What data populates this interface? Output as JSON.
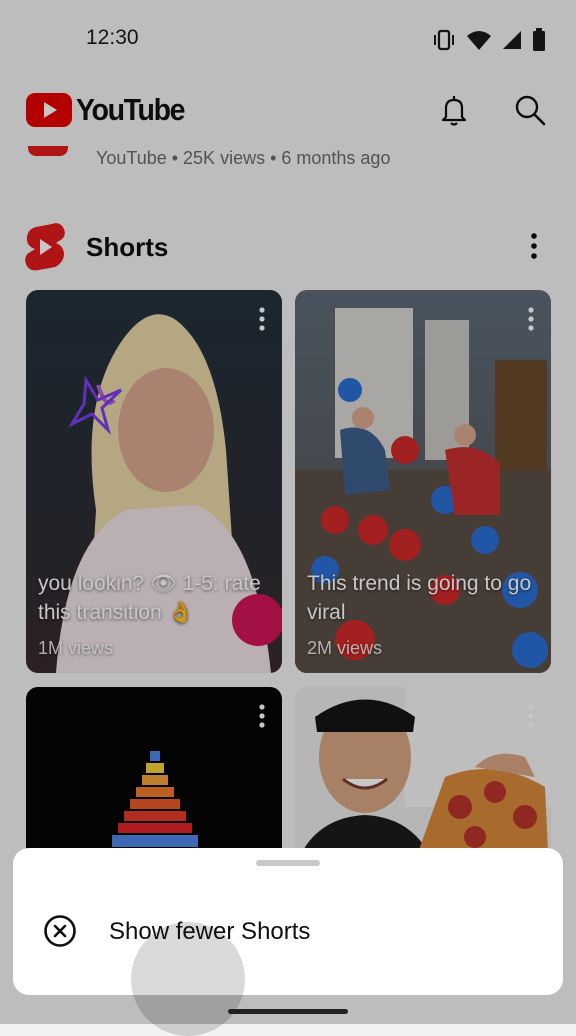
{
  "status_bar": {
    "time": "12:30"
  },
  "header": {
    "app_name": "YouTube"
  },
  "previous_video": {
    "meta": "YouTube • 25K views • 6 months ago"
  },
  "shorts": {
    "title": "Shorts",
    "cards": [
      {
        "title": "you lookin? 👁 1-5: rate this transition 👌",
        "views": "1M views"
      },
      {
        "title": "This trend is going to go viral",
        "views": "2M views"
      },
      {
        "title": "",
        "views": ""
      },
      {
        "title": "",
        "views": ""
      }
    ]
  },
  "bottom_sheet": {
    "option_label": "Show fewer Shorts"
  },
  "icons": [
    "vibrate-icon",
    "wifi-icon",
    "cell-signal-icon",
    "battery-icon",
    "youtube-logo-icon",
    "bell-icon",
    "search-icon",
    "shorts-logo-icon",
    "more-vert-icon",
    "close-circle-icon"
  ],
  "colors": {
    "brand_red": "#FF0000",
    "shorts_red": "#E21B1B"
  }
}
